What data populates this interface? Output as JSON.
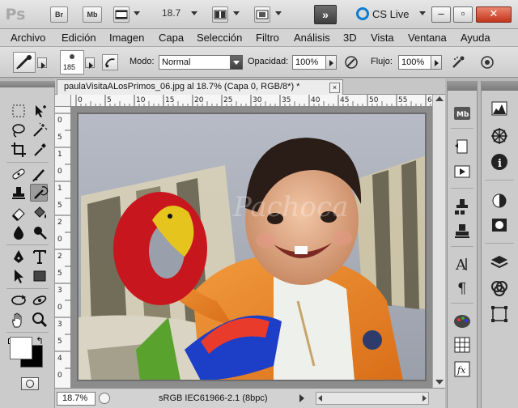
{
  "app": {
    "logo": "Ps",
    "bridge_btn": "Br",
    "minibridge_btn": "Mb",
    "zoom_level": "18.7",
    "extensions_label": "»",
    "cs_live": "CS Live"
  },
  "menu": [
    "Archivo",
    "Edición",
    "Imagen",
    "Capa",
    "Selección",
    "Filtro",
    "Análisis",
    "3D",
    "Vista",
    "Ventana",
    "Ayuda"
  ],
  "options": {
    "brush_size": "185",
    "mode_label": "Modo:",
    "mode_value": "Normal",
    "opacity_label": "Opacidad:",
    "opacity_value": "100%",
    "flow_label": "Flujo:",
    "flow_value": "100%"
  },
  "document": {
    "tab_title": "paulaVisitaALosPrimos_06.jpg al 18.7% (Capa 0, RGB/8*) *",
    "close_glyph": "×",
    "ruler_h": [
      "0",
      "5",
      "10",
      "15",
      "20",
      "25",
      "30",
      "35",
      "40",
      "45",
      "50",
      "55",
      "60"
    ],
    "ruler_v": [
      "0",
      "5",
      "1",
      "0",
      "1",
      "5",
      "2",
      "0",
      "2",
      "5",
      "3",
      "0",
      "3",
      "5",
      "4",
      "0"
    ],
    "watermark": "Pachoca"
  },
  "status": {
    "zoom": "18.7%",
    "profile": "sRGB IEC61966-2.1 (8bpc)"
  },
  "colors": {
    "foreground": "#ffffff",
    "background": "#000000",
    "accent": "#0a7fd1"
  },
  "dock1_icons": [
    "minibridge-icon",
    "history-icon",
    "actions-icon",
    "clone-source-icon",
    "tool-presets-icon",
    "character-icon",
    "paragraph-icon",
    "swatches-icon",
    "styles-icon",
    "brush-presets-icon"
  ],
  "dock2_icons": [
    "histogram-icon",
    "navigator-icon",
    "info-icon",
    "adjustments-icon",
    "masks-icon",
    "layers-icon",
    "channels-icon",
    "paths-icon"
  ]
}
